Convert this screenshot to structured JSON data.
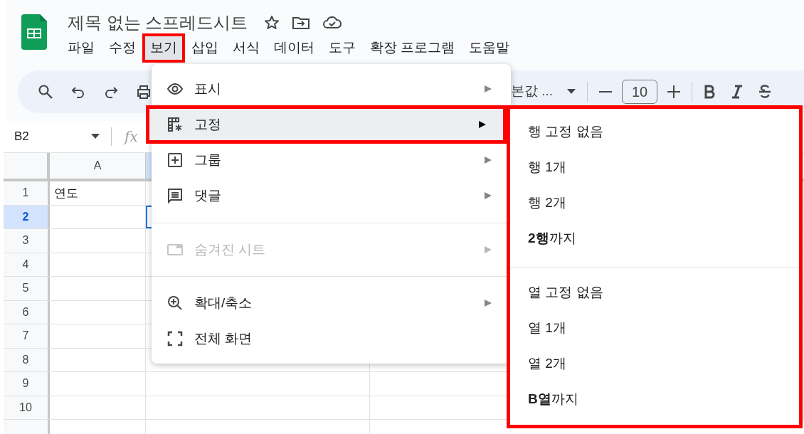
{
  "document": {
    "title": "제목 없는 스프레드시트"
  },
  "menu_bar": [
    {
      "label": "파일",
      "selected": false,
      "highlighted": false
    },
    {
      "label": "수정",
      "selected": false,
      "highlighted": false
    },
    {
      "label": "보기",
      "selected": true,
      "highlighted": true
    },
    {
      "label": "삽입",
      "selected": false,
      "highlighted": false
    },
    {
      "label": "서식",
      "selected": false,
      "highlighted": false
    },
    {
      "label": "데이터",
      "selected": false,
      "highlighted": false
    },
    {
      "label": "도구",
      "selected": false,
      "highlighted": false
    },
    {
      "label": "확장 프로그램",
      "selected": false,
      "highlighted": false
    },
    {
      "label": "도움말",
      "selected": false,
      "highlighted": false
    }
  ],
  "toolbar": {
    "font_name": "본값 ...",
    "font_size": "10"
  },
  "name_box": "B2",
  "formula_bar": {
    "icon": "fx"
  },
  "grid": {
    "columns": [
      {
        "label": "A",
        "selected": false
      },
      {
        "selected": true
      }
    ],
    "rows": [
      {
        "label": "1",
        "selected": false,
        "cells": [
          "연도"
        ]
      },
      {
        "label": "2",
        "selected": true,
        "cells": [
          ""
        ]
      },
      {
        "label": "3",
        "selected": false,
        "cells": [
          ""
        ]
      },
      {
        "label": "4",
        "selected": false,
        "cells": [
          ""
        ]
      },
      {
        "label": "5",
        "selected": false,
        "cells": [
          ""
        ]
      },
      {
        "label": "6",
        "selected": false,
        "cells": [
          ""
        ]
      },
      {
        "label": "7",
        "selected": false,
        "cells": [
          ""
        ]
      },
      {
        "label": "8",
        "selected": false,
        "cells": [
          ""
        ]
      },
      {
        "label": "9",
        "selected": false,
        "cells": [
          ""
        ]
      },
      {
        "label": "10",
        "selected": false,
        "cells": [
          ""
        ]
      }
    ]
  },
  "view_menu": {
    "sections": [
      [
        {
          "label": "표시",
          "submenu": true,
          "selected": false,
          "disabled": false,
          "highlighted": false
        },
        {
          "label": "고정",
          "submenu": true,
          "selected": true,
          "disabled": false,
          "highlighted": true
        },
        {
          "label": "그룹",
          "submenu": true,
          "selected": false,
          "disabled": false,
          "highlighted": false
        },
        {
          "label": "댓글",
          "submenu": true,
          "selected": false,
          "disabled": false,
          "highlighted": false
        }
      ],
      [
        {
          "label": "숨겨진 시트",
          "submenu": true,
          "selected": false,
          "disabled": true,
          "highlighted": false
        }
      ],
      [
        {
          "label": "확대/축소",
          "submenu": true,
          "selected": false,
          "disabled": false,
          "highlighted": false
        },
        {
          "label": "전체 화면",
          "submenu": false,
          "selected": false,
          "disabled": false,
          "highlighted": false
        }
      ]
    ]
  },
  "freeze_submenu": {
    "highlighted": true,
    "sections": [
      [
        "행 고정 없음",
        "행 1개",
        "행 2개",
        "**2행**까지"
      ],
      [
        "열 고정 없음",
        "열 1개",
        "열 2개",
        "**B열**까지"
      ]
    ]
  }
}
